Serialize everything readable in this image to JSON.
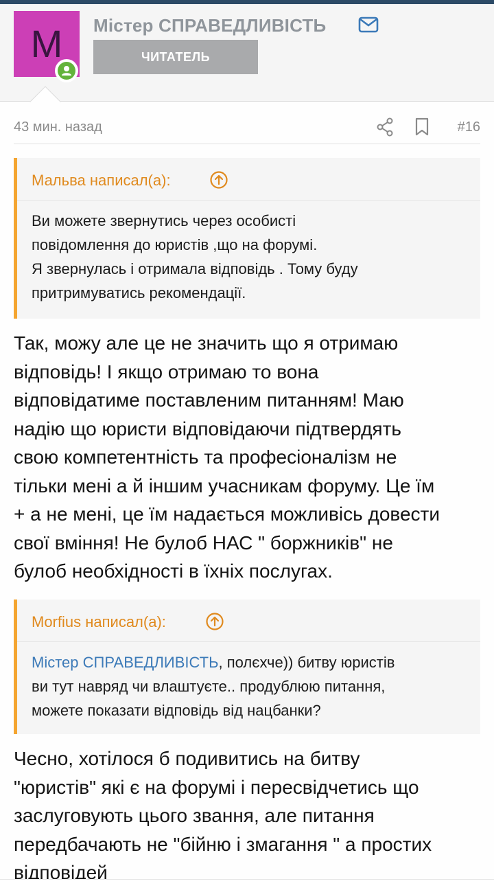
{
  "user": {
    "avatar_letter": "M",
    "avatar_color": "#cc3fb6",
    "name": "Містер СПРАВЕДЛИВІСТЬ",
    "role": "ЧИТАТЕЛЬ",
    "online_status_color": "#63b33b",
    "icons": [
      "envelope-icon",
      "user-online-icon"
    ]
  },
  "post": {
    "time": "43 мин. назад",
    "number": "#16",
    "icons": [
      "share-icon",
      "bookmark-icon"
    ]
  },
  "quote1": {
    "author": "Мальва написал(а):",
    "lines": [
      "Ви можете звернутись через особисті",
      "повідомлення до юристів ,що на форумі.",
      "Я звернулась і отримала відповідь . Тому буду",
      "притримуватись рекомендації."
    ]
  },
  "reply1": {
    "lines": [
      "Так, можу але це не значить що я отримаю",
      "відповідь! І якщо отримаю то вона",
      "відповідатиме поставленим питанням! Маю",
      "надію що юристи відповідаючи підтвердять",
      "свою компетентність та професіоналізм не",
      "тільки мені а й іншим учасникам форуму. Це їм",
      "+ а не мені, це їм надається можливісь довести",
      "свої вміння! Не булоб НАС \" боржників\" не",
      "булоб необхідності в їхніх послугах."
    ]
  },
  "quote2": {
    "author": "Morfius написал(а):",
    "mention": "Містер СПРАВЕДЛИВІСТЬ",
    "line1_rest": ", полєхче)) битву юристів",
    "line2": "ви тут навряд чи влаштуєте.. продублюю питання,",
    "line3": "можете показати відповідь від нацбанки?"
  },
  "reply2": {
    "lines": [
      "Чесно, хотілося б подивитись на битву",
      "\"юристів\" які є на форумі і пересвідчетись що",
      "заслуговують цього звання, але питання",
      "передбачають не \"бійню і змагання \" а простих",
      "відповідей"
    ]
  },
  "colors": {
    "quote_accent": "#f4a531",
    "quote_author": "#e08a1e",
    "link": "#3c7ab8",
    "role_badge": "#a9aaac",
    "header_strip": "#2c4a66"
  }
}
